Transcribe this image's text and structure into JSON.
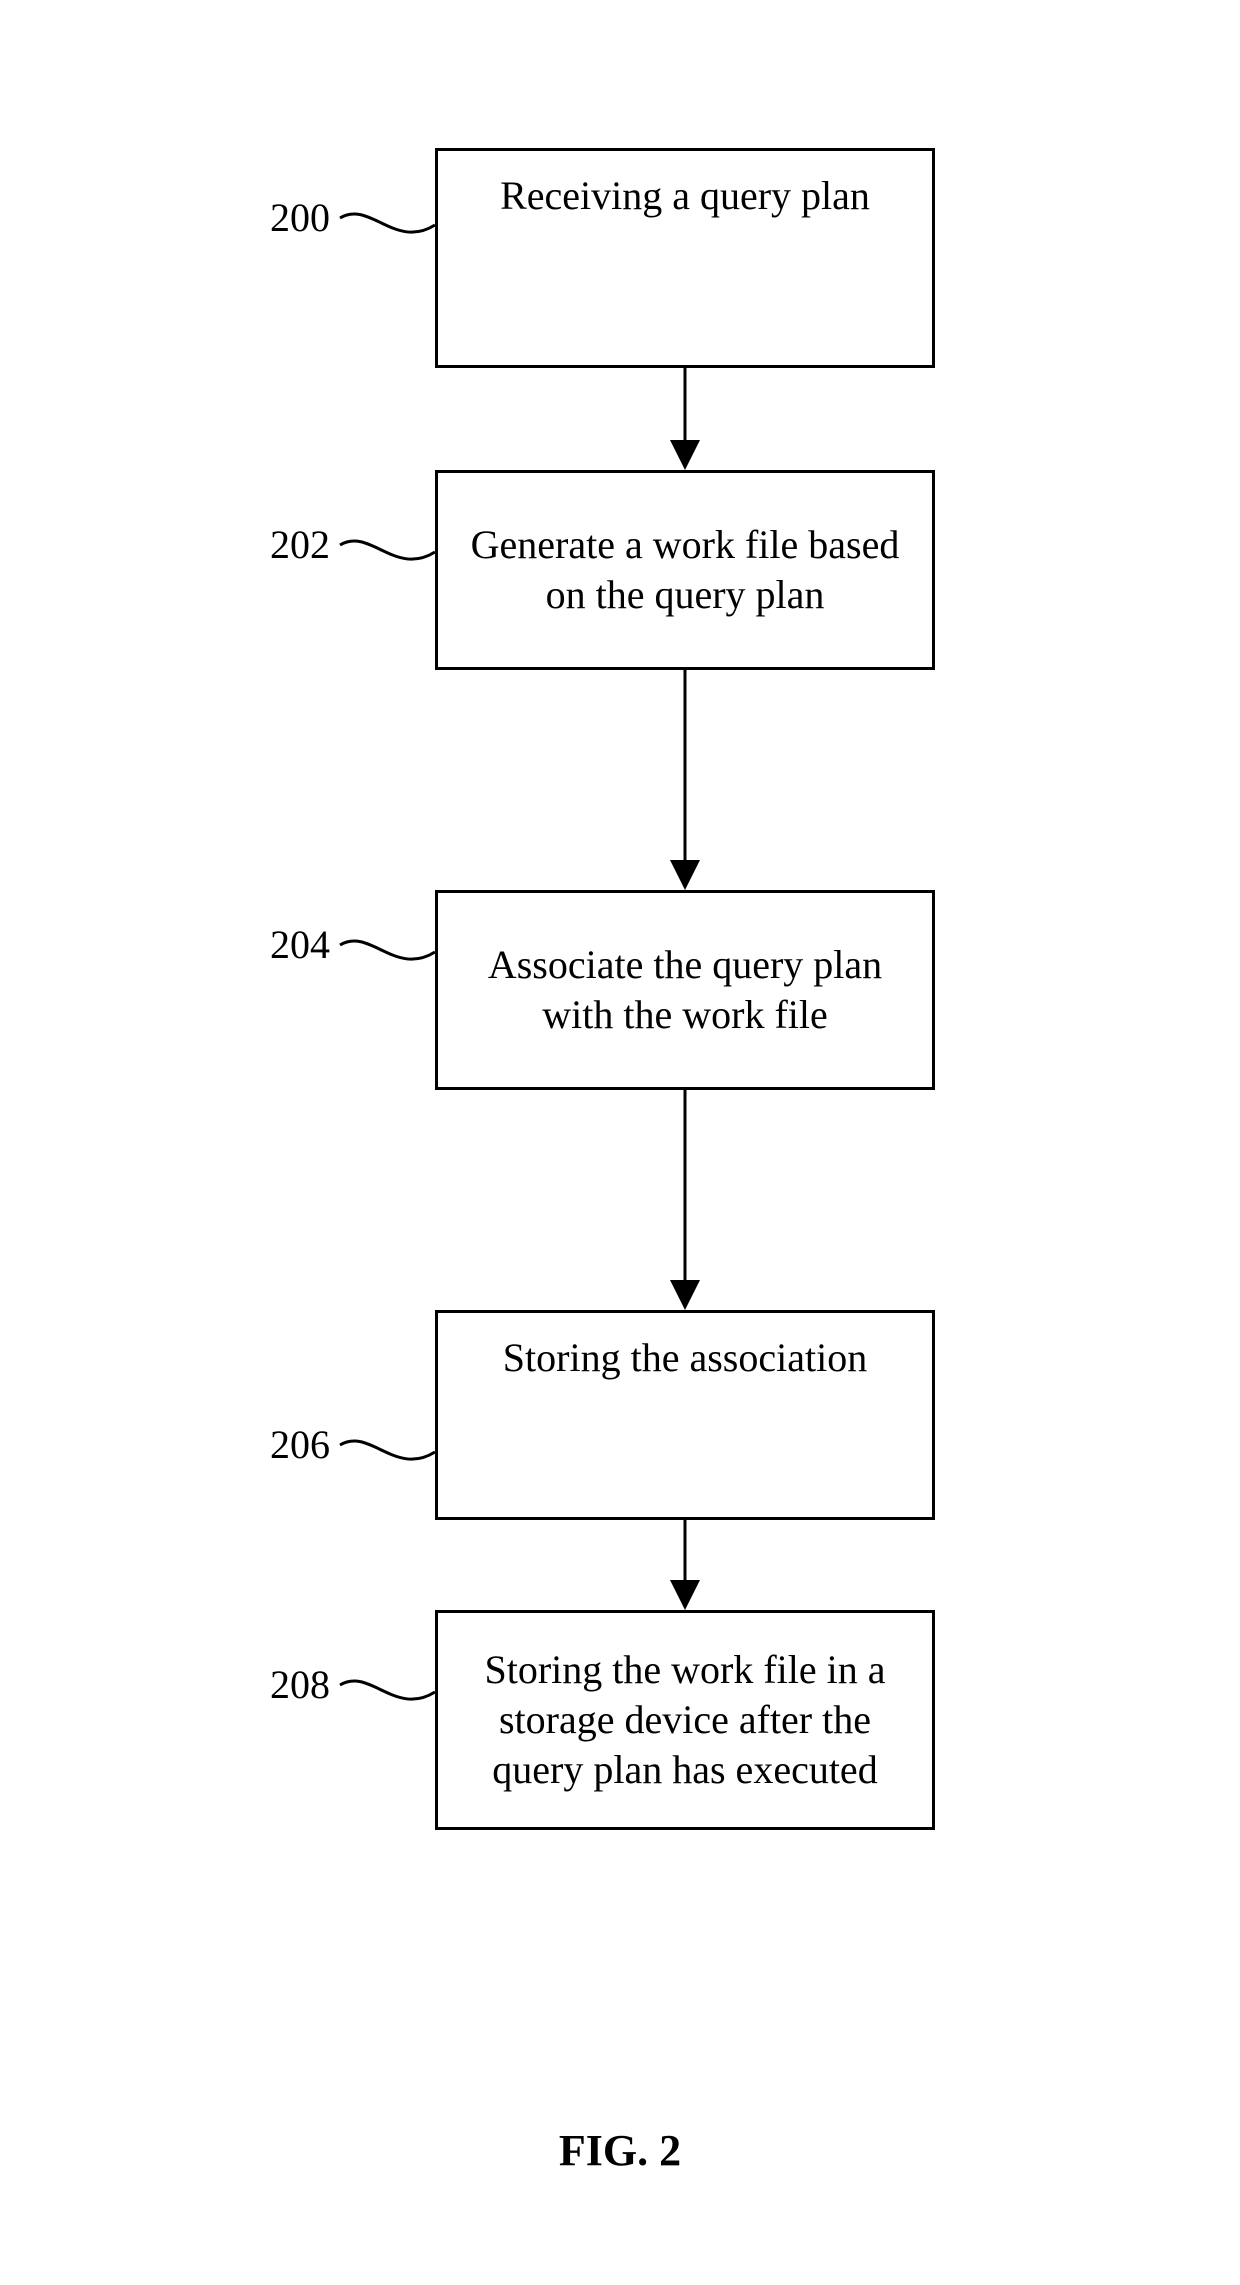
{
  "figure_label": "FIG. 2",
  "steps": [
    {
      "ref": "200",
      "text": "Receiving a query plan"
    },
    {
      "ref": "202",
      "text": "Generate a work file based on the query plan"
    },
    {
      "ref": "204",
      "text": "Associate the query plan with the work file"
    },
    {
      "ref": "206",
      "text": "Storing the association"
    },
    {
      "ref": "208",
      "text": "Storing the work file in a storage device after the query plan has executed"
    }
  ]
}
